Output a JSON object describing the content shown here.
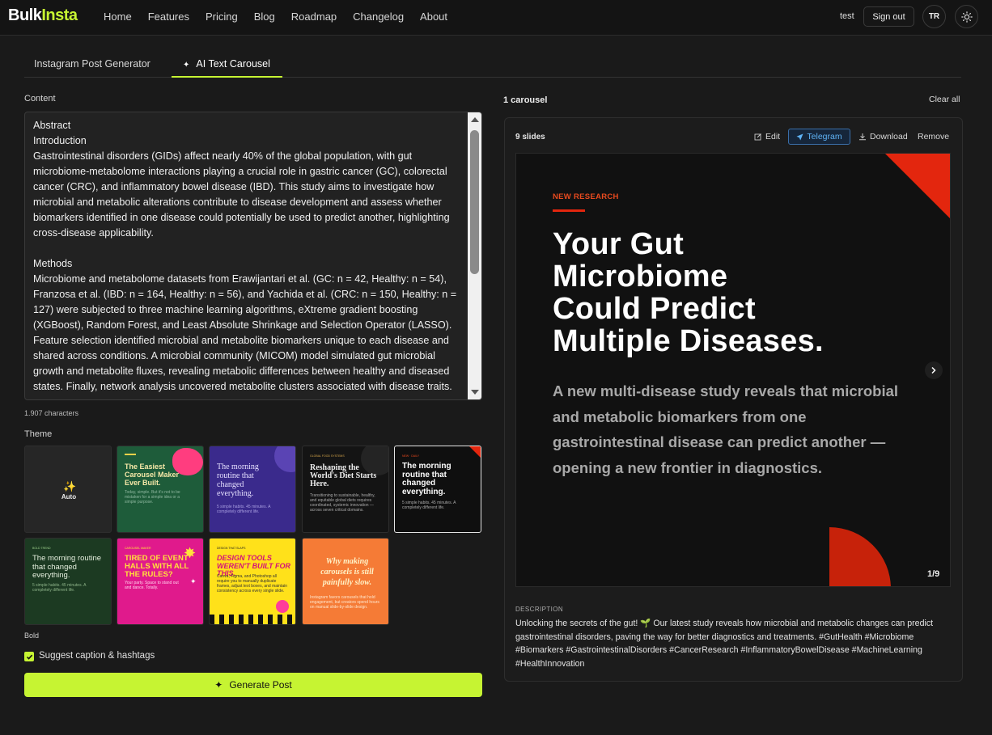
{
  "brand": {
    "name_part1": "Bulk",
    "name_part2": "Insta",
    "accent": "#c6f432"
  },
  "nav": {
    "links": [
      "Home",
      "Features",
      "Pricing",
      "Blog",
      "Roadmap",
      "Changelog",
      "About"
    ],
    "user": "test",
    "signout": "Sign out",
    "avatar": "TR",
    "theme_icon": "sun-icon"
  },
  "tabs": [
    {
      "label": "Instagram Post Generator",
      "active": false
    },
    {
      "label": "AI Text Carousel",
      "active": true,
      "icon": "sparkle-icon"
    }
  ],
  "content": {
    "label": "Content",
    "text": "Abstract\nIntroduction\nGastrointestinal disorders (GIDs) affect nearly 40% of the global population, with gut microbiome-metabolome interactions playing a crucial role in gastric cancer (GC), colorectal cancer (CRC), and inflammatory bowel disease (IBD). This study aims to investigate how microbial and metabolic alterations contribute to disease development and assess whether biomarkers identified in one disease could potentially be used to predict another, highlighting cross-disease applicability.\n\nMethods\nMicrobiome and metabolome datasets from Erawijantari et al. (GC: n = 42, Healthy: n = 54), Franzosa et al. (IBD: n = 164, Healthy: n = 56), and Yachida et al. (CRC: n = 150, Healthy: n = 127) were subjected to three machine learning algorithms, eXtreme gradient boosting (XGBoost), Random Forest, and Least Absolute Shrinkage and Selection Operator (LASSO). Feature selection identified microbial and metabolite biomarkers unique to each disease and shared across conditions. A microbial community (MICOM) model simulated gut microbial growth and metabolite fluxes, revealing metabolic differences between healthy and diseased states. Finally, network analysis uncovered metabolite clusters associated with disease traits.",
    "char_count": "1.907 characters"
  },
  "theme": {
    "label": "Theme",
    "selected_label": "Bold",
    "cards": [
      {
        "id": "auto",
        "label": "Auto"
      },
      {
        "id": "green",
        "title": "The Easiest Carousel Maker Ever Built.",
        "sub": "Today, simple. But it's not to be mistaken for a simple idea or a simple purpose."
      },
      {
        "id": "purple",
        "title": "The morning routine that changed everything.",
        "sub": "5 simple habits. 45 minutes. A completely different life."
      },
      {
        "id": "diet",
        "tag": "GLOBAL FOOD SYSTEMS",
        "title": "Reshaping the World's Diet Starts Here.",
        "sub": "Transitioning to sustainable, healthy, and equitable global diets requires coordinated, systemic innovation — across seven critical domains."
      },
      {
        "id": "bold",
        "tag": "NEW · DAILY",
        "title": "The morning routine that changed everything.",
        "sub": "5 simple habits. 45 minutes. A completely different life."
      },
      {
        "id": "forest",
        "tag": "BOLD TREND",
        "title": "The morning routine that changed everything.",
        "sub": "5 simple habits. 45 minutes. A completely different life."
      },
      {
        "id": "pink",
        "tag": "CAROUSEL MAKER",
        "title": "TIRED OF EVENT HALLS WITH ALL THE RULES?",
        "sub": "Your party. Space to stand out and dance. Totally."
      },
      {
        "id": "yellow",
        "tag": "DESIGN THAT SLAPS",
        "title": "DESIGN TOOLS WEREN'T BUILT FOR THIS.",
        "sub": "Canva, Figma, and Photoshop all require you to manually duplicate frames, adjust text boxes, and maintain consistency across every single slide."
      },
      {
        "id": "orange",
        "title": "Why making carousels is still painfully slow.",
        "sub": "Instagram favors carousels that hold engagement, but creators spend hours on manual slide-by-slide design."
      }
    ]
  },
  "suggest": {
    "label": "Suggest caption & hashtags",
    "checked": true
  },
  "generate": {
    "label": "Generate Post"
  },
  "results": {
    "count": "1 carousel",
    "clear": "Clear all",
    "slides": "9 slides",
    "actions": {
      "edit": "Edit",
      "telegram": "Telegram",
      "download": "Download",
      "remove": "Remove"
    },
    "slide": {
      "kicker": "NEW RESEARCH",
      "title_lines": [
        "Your Gut",
        "Microbiome",
        "Could Predict",
        "Multiple Diseases."
      ],
      "body": "A new multi-disease study reveals that microbial and metabolic biomarkers from one gastrointestinal disease can predict another — opening a new frontier in diagnostics.",
      "page": "1/9"
    },
    "description_label": "DESCRIPTION",
    "description": "Unlocking the secrets of the gut! 🌱 Our latest study reveals how microbial and metabolic changes can predict gastrointestinal disorders, paving the way for better diagnostics and treatments. #GutHealth #Microbiome #Biomarkers #GastrointestinalDisorders #CancerResearch #InflammatoryBowelDisease #MachineLearning #HealthInnovation"
  }
}
